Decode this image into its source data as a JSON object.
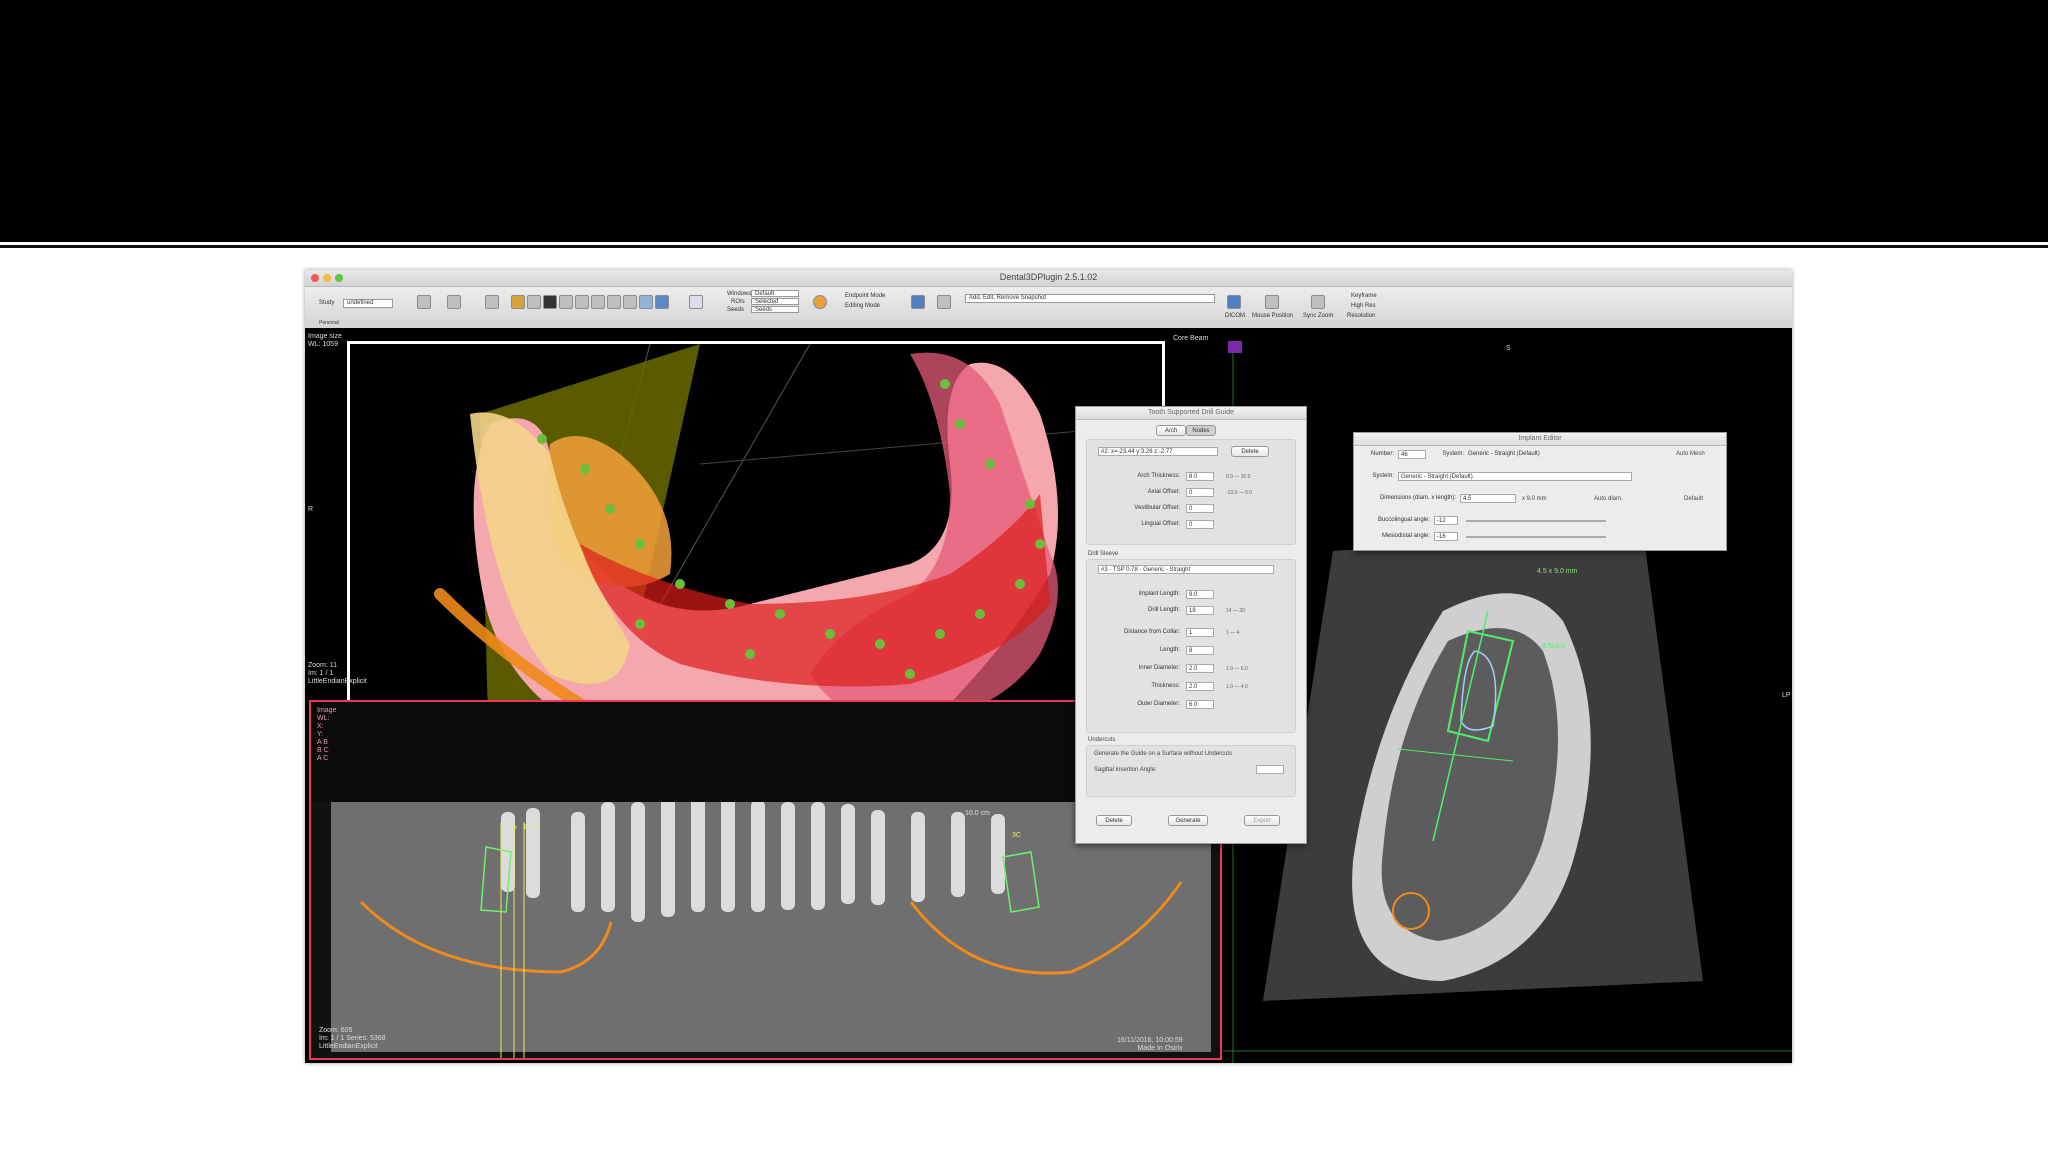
{
  "app": {
    "title": "Dental3DPlugin 2.5.1.02"
  },
  "toolbar": {
    "study_label": "Study",
    "study_value": "undefined",
    "mode_options": [
      "Default",
      "Selected",
      "Seeds"
    ],
    "mode_labels": [
      "Windows",
      "ROIs",
      "Seeds"
    ],
    "endpoint_mode": "Endpoint Mode",
    "editing_mode": "Editing Mode",
    "search_placeholder": "Add, Edit, Remove Snapshot",
    "right_items": [
      "DICOM",
      "Mouse Position",
      "Sync Zoom",
      "Resolution"
    ],
    "right_checks": [
      "Keyframe",
      "High Res"
    ]
  },
  "statusbar": {
    "left": "Personal"
  },
  "viewer3d": {
    "overlay_topleft": [
      "Image size",
      "WL: 1059"
    ],
    "overlay_left_mid": "R",
    "overlay_bottom": [
      "Zoom: 11",
      "Im: 1 / 1",
      "LittleEndianExplicit"
    ]
  },
  "axial_viewer": {
    "overlay_topleft": [
      "Image",
      "WL:",
      "X:",
      "Y:",
      "A B",
      "B C",
      "A C"
    ],
    "markers": [
      "A",
      "B",
      "C",
      "3C"
    ],
    "scale": "10.0 cm",
    "bottom_left": [
      "Zoom: 605",
      "Im: 1 / 1   Series: 5368",
      "LittleEndianExplicit"
    ],
    "bottom_right": [
      "16/11/2016, 10:00:59",
      "Made In Osirix"
    ]
  },
  "cross_viewer": {
    "top_right": [
      "Core Beam",
      "R"
    ],
    "side_label": "LP",
    "top_mark": "S",
    "implant_label": "4.5 x 9.0 mm",
    "implant_tag": "4.5x9.0"
  },
  "guide_panel": {
    "title": "Tooth Supported Drill Guide",
    "tabs": [
      "Arch",
      "Nodes"
    ],
    "node_select": "#2: x=-23.44 y:3.26 z:-2.77",
    "delete_node": "Delete",
    "arch_rows": [
      {
        "label": "Arch Thickness:",
        "value": "8.0",
        "range": "0.0 — 30.0"
      },
      {
        "label": "Axial Offset:",
        "value": "0",
        "range": "-10.0 — 5.0"
      },
      {
        "label": "Vestibular Offset:",
        "value": "0",
        "range": ""
      },
      {
        "label": "Lingual Offset:",
        "value": "0",
        "range": ""
      }
    ],
    "drill_section": "Drill Sleeve",
    "drill_select": "#3 - TSP 0.78 - Generic - Straight",
    "drill_rows": [
      {
        "label": "Implant Length:",
        "value": "9.0",
        "range": ""
      },
      {
        "label": "Drill Length:",
        "value": "18",
        "range": "14 — 30"
      },
      {
        "label": "Distance from Collar:",
        "value": "1",
        "range": "1 — 4"
      },
      {
        "label": "Length:",
        "value": "8",
        "range": ""
      },
      {
        "label": "Inner Diameter:",
        "value": "2.0",
        "range": "1.0 — 6.0"
      },
      {
        "label": "Thickness:",
        "value": "2.0",
        "range": "1.0 — 4.0"
      },
      {
        "label": "Outer Diameter:",
        "value": "6.0",
        "range": ""
      }
    ],
    "undercuts_section": "Undercuts",
    "undercuts_check": "Generate the Guide on a Surface without Undercuts",
    "sagittal_label": "Sagittal insertion Angle:",
    "buttons": [
      "Delete",
      "Generate",
      "Export"
    ]
  },
  "implant_panel": {
    "title": "Implant Editor",
    "number_label": "Number:",
    "number_value": "46",
    "system_label": "System:",
    "system_value": "Generic - Straight (Default)",
    "auto_mesh": "Auto Mesh",
    "system2_value": "Generic - Straight (Default)",
    "dimensions_label": "Dimensions (diam. x length):",
    "dim_value": "4.5",
    "dim_length": "x 9.0 mm",
    "auto_diam": "Auto diam.",
    "default": "Default",
    "bucco_label": "Buccolingual angle:",
    "bucco_value": "-12",
    "mesio_label": "Mesiodistal angle:",
    "mesio_value": "-16"
  },
  "colors": {
    "accent_red": "#e83a5a",
    "canal_orange": "#f08a1a",
    "implant_green": "#4ef06a"
  }
}
